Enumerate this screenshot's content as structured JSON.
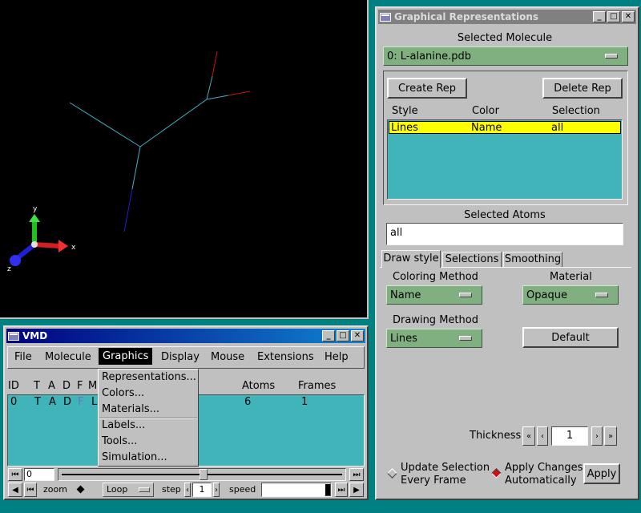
{
  "graph_win": {
    "title": "Graphical Representations",
    "selected_molecule_label": "Selected Molecule",
    "selected_molecule_value": "0: L-alanine.pdb",
    "create_rep": "Create Rep",
    "delete_rep": "Delete Rep",
    "rep_headers": {
      "style": "Style",
      "color": "Color",
      "selection": "Selection"
    },
    "rep_rows": [
      {
        "style": "Lines",
        "color": "Name",
        "selection": "all"
      }
    ],
    "selected_atoms_label": "Selected Atoms",
    "selected_atoms_value": "all",
    "tabs": [
      "Draw style",
      "Selections",
      "Smoothing"
    ],
    "coloring_label": "Coloring Method",
    "coloring_value": "Name",
    "material_label": "Material",
    "material_value": "Opaque",
    "drawing_label": "Drawing Method",
    "drawing_value": "Lines",
    "default_btn": "Default",
    "thickness_label": "Thickness",
    "thickness_value": "1",
    "update_sel": "Update Selection Every Frame",
    "update_sel_line1": "Update Selection",
    "update_sel_line2": "Every Frame",
    "apply_changes_line1": "Apply Changes",
    "apply_changes_line2": "Automatically",
    "apply_btn": "Apply"
  },
  "axes": {
    "x": "x",
    "y": "y",
    "z": "z"
  },
  "vmd_win": {
    "title": "VMD",
    "menu": [
      "File",
      "Molecule",
      "Graphics",
      "Display",
      "Mouse",
      "Extensions",
      "Help"
    ],
    "list_headers": {
      "id": "ID",
      "t": "T",
      "a": "A",
      "d": "D",
      "f": "F",
      "m": "M",
      "atoms": "Atoms",
      "frames": "Frames"
    },
    "list_row": {
      "id": "0",
      "t": "T",
      "a": "A",
      "d": "D",
      "f": "F",
      "m": "L",
      "atoms": "6",
      "frames": "1"
    },
    "frame_value": "0",
    "zoom_label": "zoom",
    "loop_label": "Loop",
    "step_label": "step",
    "step_value": "1",
    "speed_label": "speed"
  },
  "graphics_menu": {
    "items": [
      "Representations...",
      "Colors...",
      "Materials...",
      "Labels...",
      "Tools...",
      "Simulation..."
    ]
  },
  "colors": {
    "desktop": "#008080",
    "titlebar_active": "#000080",
    "titlebar_inactive": "#808080",
    "bond_cyan": "#40b0c0",
    "bond_red": "#d01010",
    "bond_blue": "#2020d0",
    "selected_row": "#ffff00",
    "option_green": "#80b080",
    "list_teal": "#40b4b8"
  }
}
